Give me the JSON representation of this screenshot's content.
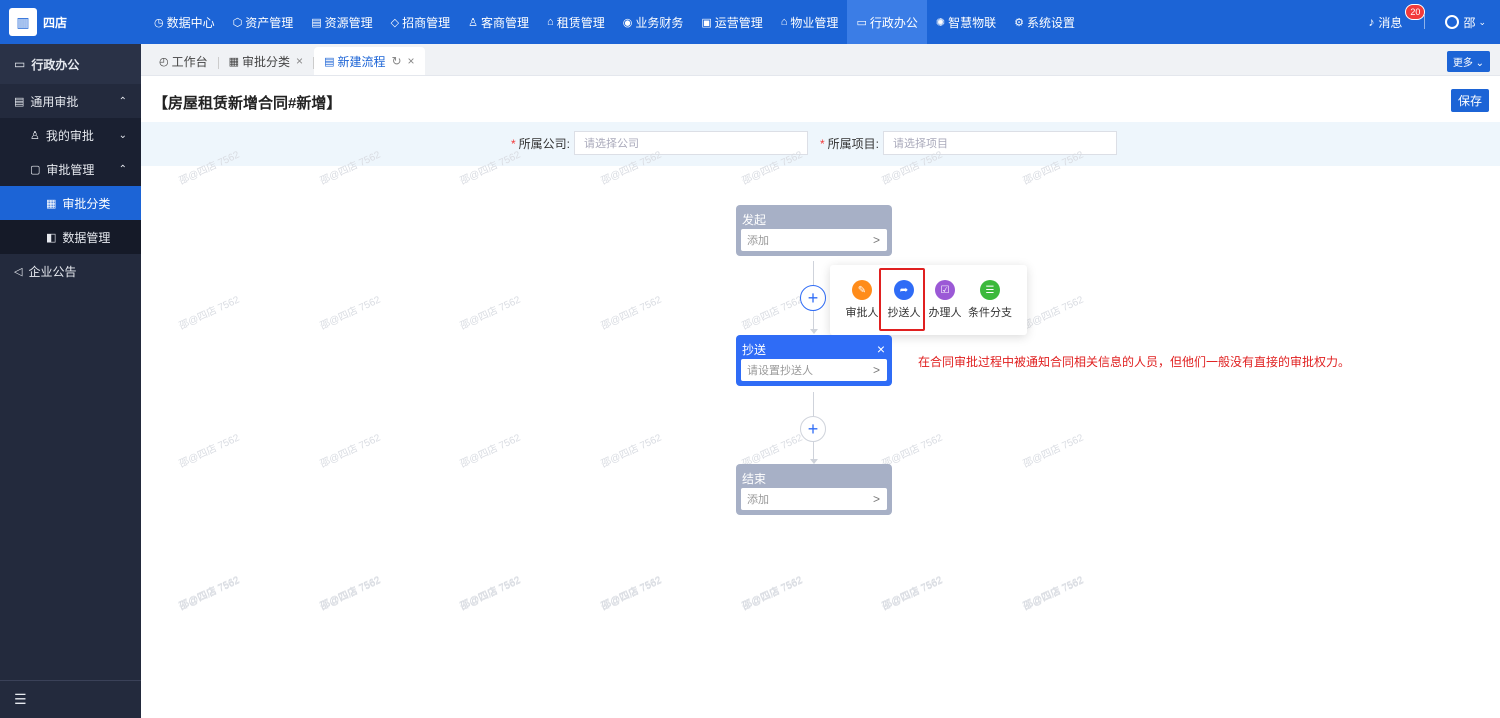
{
  "app": {
    "brand": "四店"
  },
  "topnav": [
    {
      "label": "数据中心",
      "icon": "chart-icon",
      "glyph": "◷"
    },
    {
      "label": "资产管理",
      "icon": "cube-icon",
      "glyph": "⬡"
    },
    {
      "label": "资源管理",
      "icon": "building-icon",
      "glyph": "▤"
    },
    {
      "label": "招商管理",
      "icon": "tag-icon",
      "glyph": "◇"
    },
    {
      "label": "客商管理",
      "icon": "users-icon",
      "glyph": "♙"
    },
    {
      "label": "租赁管理",
      "icon": "home-icon",
      "glyph": "⌂"
    },
    {
      "label": "业务财务",
      "icon": "coin-icon",
      "glyph": "◉"
    },
    {
      "label": "运营管理",
      "icon": "ops-icon",
      "glyph": "▣"
    },
    {
      "label": "物业管理",
      "icon": "property-icon",
      "glyph": "⌂"
    },
    {
      "label": "行政办公",
      "icon": "monitor-icon",
      "glyph": "▭"
    },
    {
      "label": "智慧物联",
      "icon": "iot-icon",
      "glyph": "✺"
    },
    {
      "label": "系统设置",
      "icon": "gear-icon",
      "glyph": "⚙"
    }
  ],
  "topnav_active_index": 9,
  "header_right": {
    "messages_label": "消息",
    "messages_count": "20",
    "user_name": "邵"
  },
  "sidebar": {
    "title": "行政办公",
    "items": [
      {
        "label": "通用审批",
        "icon": "doc-icon",
        "glyph": "▤",
        "level": 1,
        "arrow": "⌃"
      },
      {
        "label": "我的审批",
        "icon": "person-icon",
        "glyph": "♙",
        "level": 2,
        "arrow": "⌄"
      },
      {
        "label": "审批管理",
        "icon": "clipboard-icon",
        "glyph": "▢",
        "level": 2,
        "arrow": "⌃"
      },
      {
        "label": "审批分类",
        "icon": "grid-icon",
        "glyph": "▦",
        "level": 3,
        "selected": true
      },
      {
        "label": "数据管理",
        "icon": "data-icon",
        "glyph": "◧",
        "level": 3
      },
      {
        "label": "企业公告",
        "icon": "speaker-icon",
        "glyph": "◁",
        "level": 1
      }
    ]
  },
  "tabs": [
    {
      "label": "工作台",
      "icon": "dashboard-icon",
      "glyph": "◴"
    },
    {
      "label": "审批分类",
      "icon": "grid-icon",
      "glyph": "▦",
      "closable": true
    },
    {
      "label": "新建流程",
      "icon": "form-icon",
      "glyph": "▤",
      "closable": true,
      "refresh": true,
      "active": true
    }
  ],
  "more_label": "更多",
  "page": {
    "title": "【房屋租赁新增合同#新增】",
    "save_label": "保存",
    "company_label": "所属公司:",
    "company_placeholder": "请选择公司",
    "project_label": "所属项目:",
    "project_placeholder": "请选择项目"
  },
  "watermark_text": "邵@四店 7562",
  "flow": {
    "start": {
      "title": "发起",
      "placeholder": "添加"
    },
    "cc": {
      "title": "抄送",
      "placeholder": "请设置抄送人"
    },
    "end": {
      "title": "结束",
      "placeholder": "添加"
    }
  },
  "popup_options": [
    {
      "label": "审批人",
      "icon": "approver-icon",
      "color": "#ff8c1a",
      "glyph": "✎"
    },
    {
      "label": "抄送人",
      "icon": "cc-icon",
      "color": "#2f6cf6",
      "glyph": "➦"
    },
    {
      "label": "办理人",
      "icon": "handler-icon",
      "color": "#9b59d6",
      "glyph": "☑"
    },
    {
      "label": "条件分支",
      "icon": "branch-icon",
      "color": "#3cb93c",
      "glyph": "☰"
    }
  ],
  "annotation": "在合同审批过程中被通知合同相关信息的人员，但他们一般没有直接的审批权力。"
}
